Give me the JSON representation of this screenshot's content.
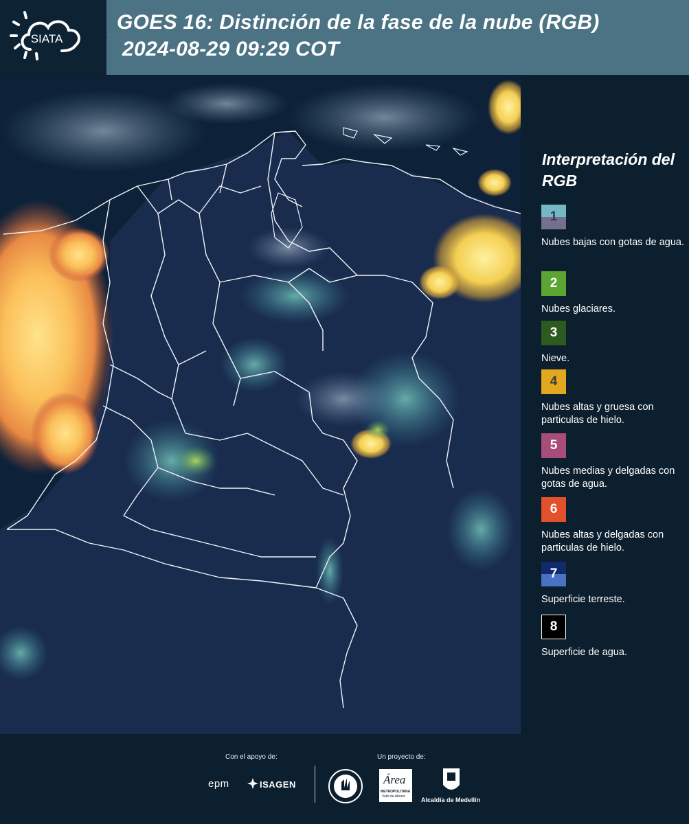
{
  "header": {
    "logo_text": "SIATA",
    "title_line1": "GOES 16: Distinción de la fase de la nube (RGB)",
    "title_line2": "2024-08-29 09:29 COT"
  },
  "legend": {
    "title": "Interpretación del RGB",
    "items": [
      {
        "num": "1",
        "label": "Nubes bajas con gotas de agua.",
        "color_top": "#74b8c6",
        "color_bottom": "#75708e"
      },
      {
        "num": "2",
        "label": "Nubes glaciares.",
        "color": "#5da532"
      },
      {
        "num": "3",
        "label": "Nieve.",
        "color": "#2d5a1f"
      },
      {
        "num": "4",
        "label": "Nubes altas y gruesa con particulas de hielo.",
        "color": "#e2a91e"
      },
      {
        "num": "5",
        "label": "Nubes medias y delgadas con gotas de agua.",
        "color": "#a84d7a"
      },
      {
        "num": "6",
        "label": "Nubes altas y delgadas con particulas de hielo.",
        "color": "#e2502c"
      },
      {
        "num": "7",
        "label": "Superficie terreste.",
        "color_top": "#122a6b",
        "color_bottom": "#4a72c4"
      },
      {
        "num": "8",
        "label": "Superficie de agua.",
        "color": "#000000"
      }
    ]
  },
  "footer": {
    "support_label": "Con el apoyo de:",
    "project_label": "Un proyecto de:",
    "sponsors": [
      "epm",
      "ISAGEN"
    ],
    "area_text": "Área",
    "metro_text": "METROPOLITANA",
    "valle_text": "Valle de Aburrá",
    "alcaldia_text": "Alcaldía de Medellín"
  }
}
